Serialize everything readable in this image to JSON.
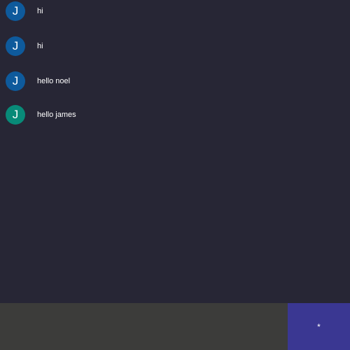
{
  "messages": [
    {
      "avatar_letter": "J",
      "text": "hi",
      "avatar_color": "#0e5a9c"
    },
    {
      "avatar_letter": "J",
      "text": "hi",
      "avatar_color": "#0e5a9c"
    },
    {
      "avatar_letter": "J",
      "text": "hello noel",
      "avatar_color": "#0e5a9c"
    },
    {
      "avatar_letter": "J",
      "text": "hello james",
      "avatar_color": "#088a78"
    }
  ],
  "composer": {
    "value": "",
    "placeholder": ""
  },
  "send_button": {
    "label": "*",
    "color": "#3a3792"
  },
  "colors": {
    "background": "#272635",
    "composer_background": "#3c3c3a",
    "text": "#ffffff"
  }
}
